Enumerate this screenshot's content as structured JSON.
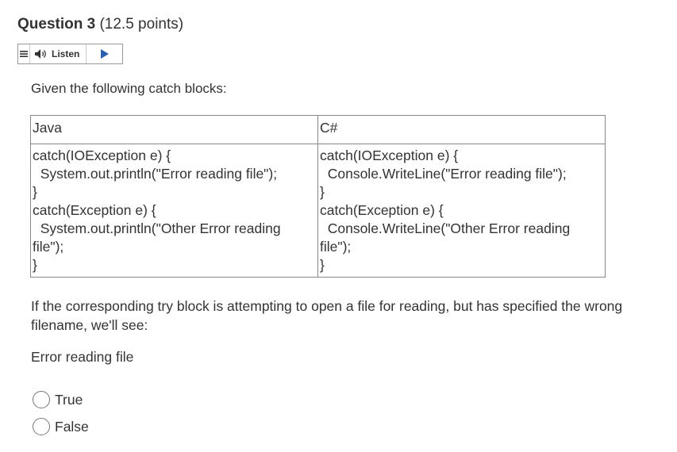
{
  "question": {
    "title": "Question 3",
    "points": "(12.5 points)"
  },
  "listen": {
    "label": "Listen"
  },
  "intro": "Given the following catch blocks:",
  "table": {
    "headers": [
      "Java",
      "C#"
    ],
    "java_lines": [
      "catch(IOException e) {",
      "  System.out.println(\"Error reading file\");",
      "}",
      "catch(Exception e) {",
      "  System.out.println(\"Other Error reading",
      "file\");",
      "}"
    ],
    "csharp_lines": [
      "catch(IOException e) {",
      "  Console.WriteLine(\"Error reading file\");",
      "}",
      "catch(Exception e) {",
      "  Console.WriteLine(\"Other Error reading",
      "file\");",
      "}"
    ]
  },
  "prompt": "If the corresponding try block is attempting to open a file for reading, but has specified the wrong filename, we'll see:",
  "statement": "Error reading file",
  "options": [
    "True",
    "False"
  ]
}
